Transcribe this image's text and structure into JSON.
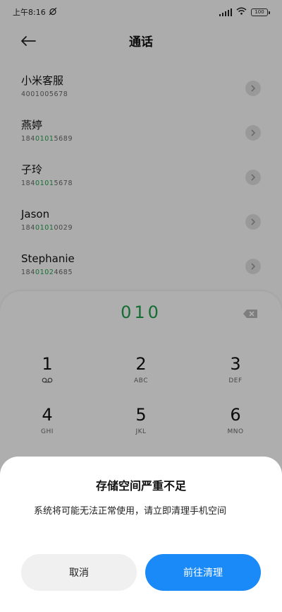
{
  "status_bar": {
    "time": "上午8:16",
    "battery": "100"
  },
  "header": {
    "title": "通话"
  },
  "contacts": [
    {
      "name": "小米客服",
      "number_prefix": "4001005678",
      "number_highlight": "",
      "number_suffix": ""
    },
    {
      "name": "燕婷",
      "number_prefix": "184",
      "number_highlight": "0101",
      "number_suffix": "5689"
    },
    {
      "name": "子玲",
      "number_prefix": "184",
      "number_highlight": "0101",
      "number_suffix": "5678"
    },
    {
      "name": "Jason",
      "number_prefix": "184",
      "number_highlight": "0101",
      "number_suffix": "0029"
    },
    {
      "name": "Stephanie",
      "number_prefix": "184",
      "number_highlight": "0102",
      "number_suffix": "4685"
    }
  ],
  "dialer": {
    "input": "010",
    "keys": [
      {
        "digit": "1",
        "sub": "",
        "sub_icon": "voicemail-icon"
      },
      {
        "digit": "2",
        "sub": "ABC"
      },
      {
        "digit": "3",
        "sub": "DEF"
      },
      {
        "digit": "4",
        "sub": "GHI"
      },
      {
        "digit": "5",
        "sub": "JKL"
      },
      {
        "digit": "6",
        "sub": "MNO"
      }
    ]
  },
  "dialog": {
    "title": "存储空间严重不足",
    "message": "系统将可能无法正常使用，请立即清理手机空间",
    "cancel_label": "取消",
    "confirm_label": "前往清理"
  },
  "colors": {
    "highlight": "#1e9e4a",
    "accent": "#1a8af8"
  }
}
